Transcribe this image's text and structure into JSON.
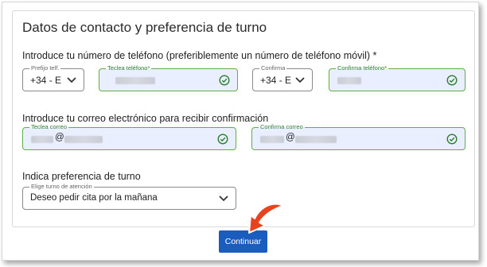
{
  "section": {
    "title": "Datos de contacto y preferencia de turno"
  },
  "phone": {
    "question": "Introduce tu número de teléfono (preferiblemente un número de teléfono móvil) *",
    "prefix_legend": "Prefijo telf.",
    "prefix_value": "+34 - E",
    "phone_legend": "Teclea teléfono*",
    "confirm_prefix_legend": "Confirma",
    "confirm_prefix_value": "+34 - E",
    "confirm_phone_legend": "Confirma teléfono*"
  },
  "email": {
    "question": "Introduce tu correo electrónico para recibir confirmación",
    "email_legend": "Teclea correo",
    "confirm_legend": "Confirma correo",
    "at_symbol": "@"
  },
  "turno": {
    "question": "Indica preferencia de turno",
    "legend": "Elige turno de atención",
    "value": "Deseo pedir cita por la mañana"
  },
  "actions": {
    "submit_label": "Continuar"
  },
  "colors": {
    "valid_border": "#5fae45",
    "valid_bg": "#e9efff",
    "primary": "#1a5dbf",
    "arrow": "#e8421e"
  },
  "icons": [
    "chevron-down-icon",
    "check-circle-icon",
    "arrow-icon"
  ]
}
